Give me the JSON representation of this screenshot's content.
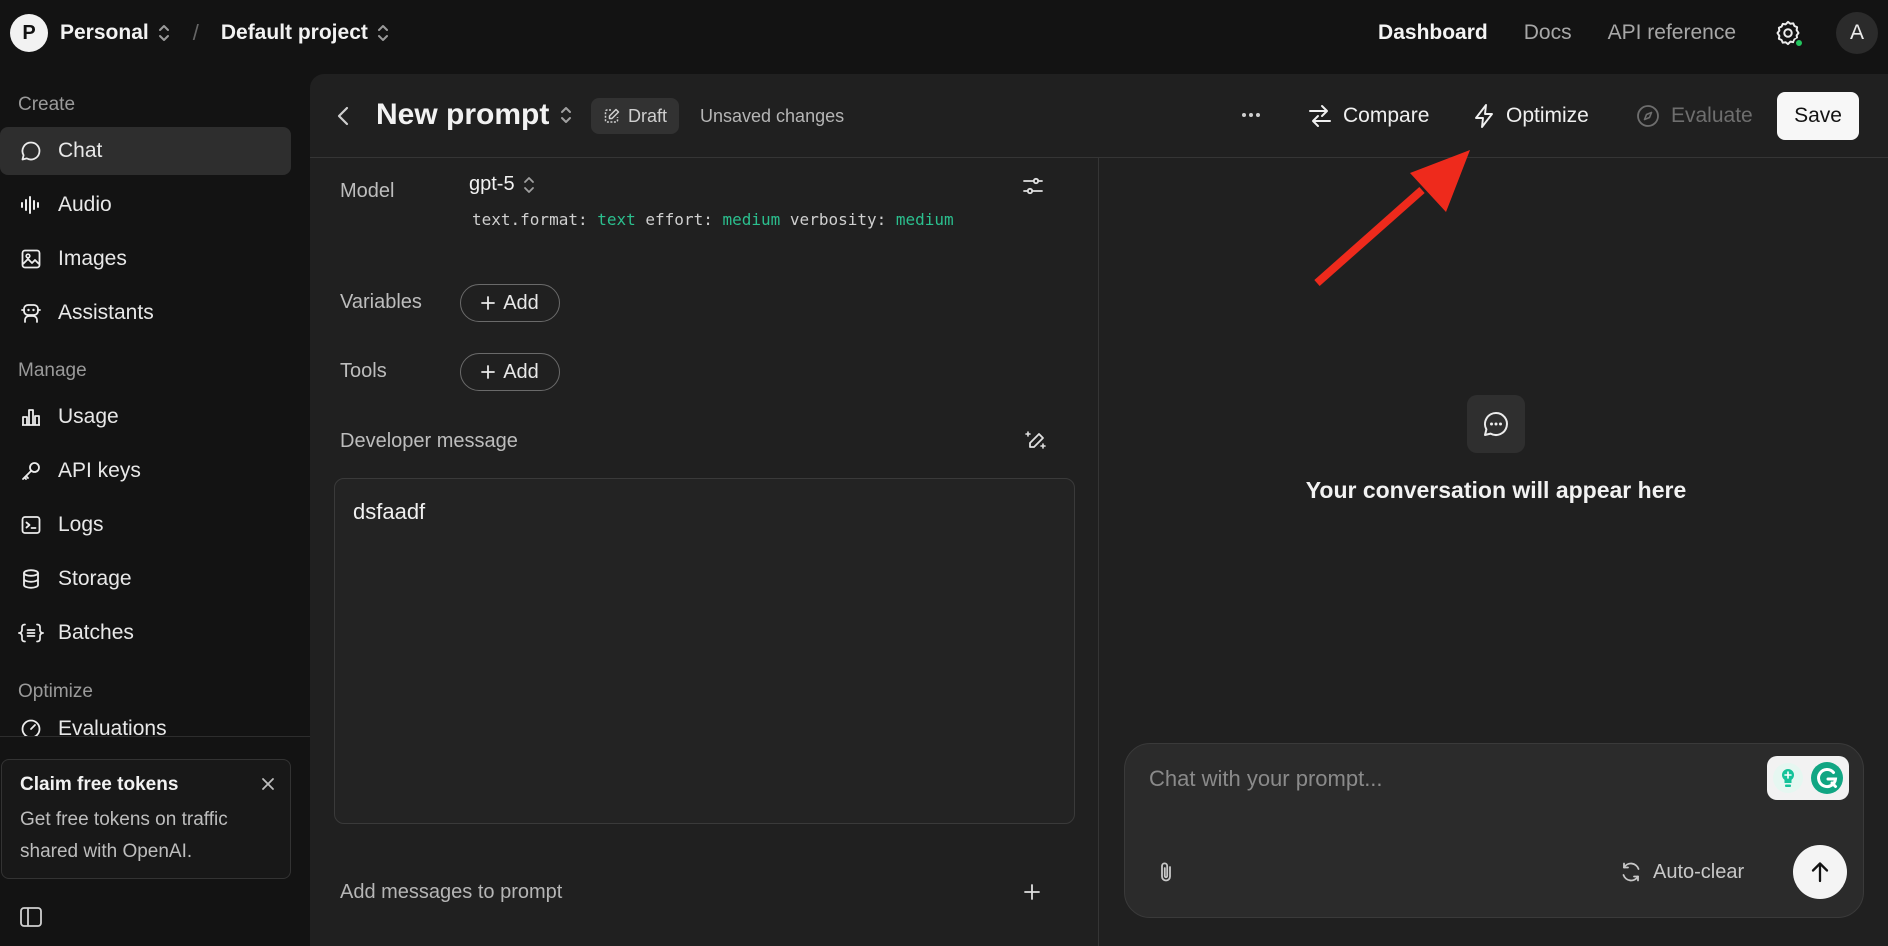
{
  "topbar": {
    "org_initial": "P",
    "org_name": "Personal",
    "separator": "/",
    "project_name": "Default project",
    "nav": [
      "Dashboard",
      "Docs",
      "API reference"
    ],
    "user_initial": "A"
  },
  "sidebar": {
    "sections": [
      "Create",
      "Manage",
      "Optimize"
    ],
    "create_items": [
      "Chat",
      "Audio",
      "Images",
      "Assistants"
    ],
    "manage_items": [
      "Usage",
      "API keys",
      "Logs",
      "Storage",
      "Batches"
    ],
    "optimize_partial": "Evaluations",
    "promo": {
      "title": "Claim free tokens",
      "text": "Get free tokens on traffic shared with OpenAI."
    }
  },
  "header": {
    "title": "New prompt",
    "badge": "Draft",
    "status": "Unsaved changes",
    "compare": "Compare",
    "optimize": "Optimize",
    "evaluate": "Evaluate",
    "save": "Save"
  },
  "editor": {
    "model_label": "Model",
    "model_value": "gpt-5",
    "params": {
      "k1": "text.format:",
      "v1": "text",
      "k2": "effort:",
      "v2": "medium",
      "k3": "verbosity:",
      "v3": "medium"
    },
    "variables_label": "Variables",
    "tools_label": "Tools",
    "add_label": "Add",
    "developer_label": "Developer message",
    "developer_text": "dsfaadf",
    "add_messages": "Add messages to prompt"
  },
  "chat": {
    "empty_text": "Your conversation will appear here",
    "placeholder": "Chat with your prompt...",
    "autoclear": "Auto-clear"
  },
  "colors": {
    "accent_green": "#2bbf8e",
    "status_green": "#22c55e",
    "annotation_red": "#ee2a1c"
  }
}
